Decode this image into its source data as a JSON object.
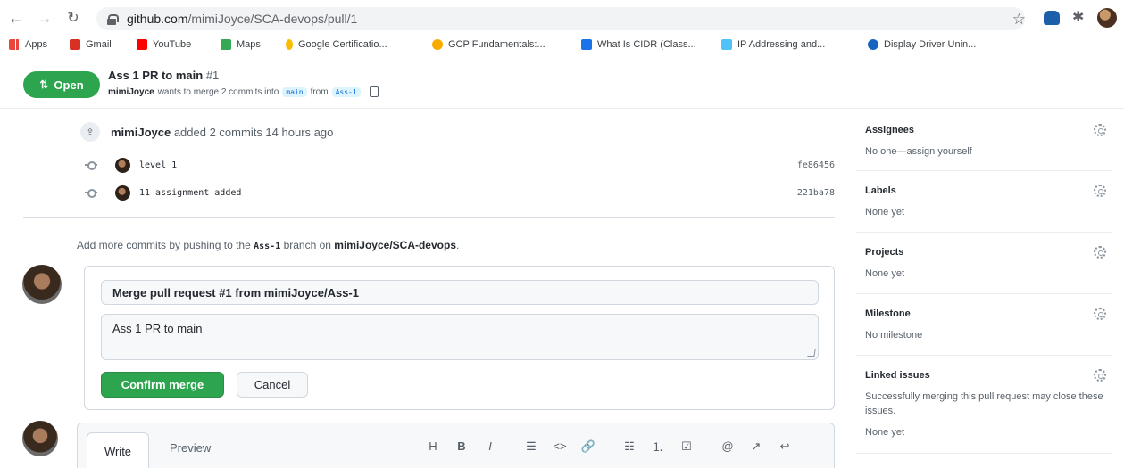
{
  "browser": {
    "url_host": "github.com",
    "url_path": "/mimiJoyce/SCA-devops/pull/1",
    "bookmarks": [
      {
        "label": "Apps",
        "color": "#e8453c"
      },
      {
        "label": "Gmail",
        "color": "#d93025"
      },
      {
        "label": "YouTube",
        "color": "#ff0000"
      },
      {
        "label": "Maps",
        "color": "#34a853"
      },
      {
        "label": "Google Certificatio...",
        "color": "#fbbc04"
      },
      {
        "label": "GCP Fundamentals:...",
        "color": "#f9ab00"
      },
      {
        "label": "What Is CIDR (Class...",
        "color": "#1a73e8"
      },
      {
        "label": "IP Addressing and...",
        "color": "#4fc3f7"
      },
      {
        "label": "Display Driver Unin...",
        "color": "#1565c0"
      }
    ]
  },
  "pr": {
    "state": "Open",
    "title": "Ass 1 PR to main",
    "number": "#1",
    "author": "mimiJoyce",
    "meta_text": "wants to merge 2 commits into",
    "base_branch": "main",
    "from_text": "from",
    "head_branch": "Ass-1"
  },
  "timeline": {
    "actor": "mimiJoyce",
    "event_text": "added 2 commits 14 hours ago",
    "commits": [
      {
        "message": "level 1",
        "sha": "fe86456"
      },
      {
        "message": "11 assignment added",
        "sha": "221ba78"
      }
    ],
    "push_hint_prefix": "Add more commits by pushing to the",
    "push_hint_branch": "Ass-1",
    "push_hint_mid": "branch on",
    "push_hint_repo": "mimiJoyce/SCA-devops",
    "push_hint_suffix": "."
  },
  "merge": {
    "commit_title": "Merge pull request #1 from mimiJoyce/Ass-1",
    "commit_body": "Ass 1 PR to main",
    "confirm_label": "Confirm merge",
    "cancel_label": "Cancel"
  },
  "editor": {
    "tab_write": "Write",
    "tab_preview": "Preview",
    "tools": [
      "H",
      "B",
      "I",
      "☰",
      "<>",
      "🔗",
      "☷",
      "⒈",
      "☑",
      "@",
      "↗",
      "↩"
    ]
  },
  "sidebar": {
    "sections": [
      {
        "heading": "Assignees",
        "value": "No one—assign yourself"
      },
      {
        "heading": "Labels",
        "value": "None yet"
      },
      {
        "heading": "Projects",
        "value": "None yet"
      },
      {
        "heading": "Milestone",
        "value": "No milestone"
      },
      {
        "heading": "Linked issues",
        "value": "Successfully merging this pull request may close these issues.",
        "value2": "None yet"
      }
    ]
  },
  "colors": {
    "accent_green": "#2da44e",
    "link_blue": "#0969da"
  }
}
